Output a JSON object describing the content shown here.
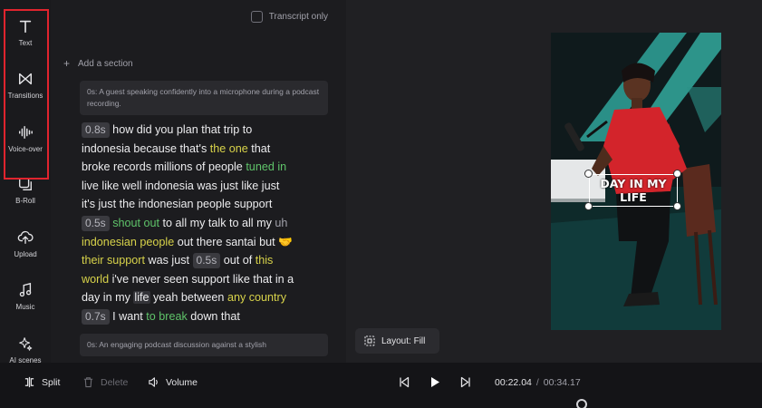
{
  "rail": {
    "items": [
      {
        "label": "Text",
        "icon": "text-icon"
      },
      {
        "label": "Transitions",
        "icon": "transitions-icon"
      },
      {
        "label": "Voice-over",
        "icon": "voice-over-icon"
      },
      {
        "label": "B-Roll",
        "icon": "b-roll-icon"
      },
      {
        "label": "Upload",
        "icon": "upload-icon"
      },
      {
        "label": "Music",
        "icon": "music-icon"
      },
      {
        "label": "AI scenes",
        "icon": "ai-sparkle-icon"
      }
    ],
    "highlight_color": "#e0242e"
  },
  "transcript": {
    "transcript_only_label": "Transcript only",
    "add_section_label": "Add a section",
    "scene_1": "0s:  A guest speaking confidently into a microphone during a podcast recording.",
    "scene_2": "0s:  An engaging podcast discussion against a stylish",
    "lines": [
      [
        {
          "t": "0.8s",
          "c": "ts"
        },
        {
          "t": " how did you plan that trip to"
        }
      ],
      [
        {
          "t": "indonesia because that's "
        },
        {
          "t": "the one",
          "c": "y"
        },
        {
          "t": " that"
        }
      ],
      [
        {
          "t": "broke records millions of people "
        },
        {
          "t": "tuned in",
          "c": "g"
        }
      ],
      [
        {
          "t": "live like well indonesia was just like just"
        }
      ],
      [
        {
          "t": "it's just the indonesian people support"
        }
      ],
      [
        {
          "t": "0.5s",
          "c": "ts"
        },
        {
          "t": " "
        },
        {
          "t": "shout out",
          "c": "g"
        },
        {
          "t": " to all my talk to all my "
        },
        {
          "t": "uh",
          "c": "m"
        }
      ],
      [
        {
          "t": "indonesian people",
          "c": "y"
        },
        {
          "t": " out there santai but "
        },
        {
          "t": "🤝",
          "c": "y"
        }
      ],
      [
        {
          "t": "their support",
          "c": "y"
        },
        {
          "t": " was just "
        },
        {
          "t": "0.5s",
          "c": "ts"
        },
        {
          "t": " out of "
        },
        {
          "t": "this",
          "c": "y"
        }
      ],
      [
        {
          "t": "world",
          "c": "y"
        },
        {
          "t": " i've never seen support like that in a"
        }
      ],
      [
        {
          "t": "day in my "
        },
        {
          "t": "life",
          "c": "sel"
        },
        {
          "t": " yeah between "
        },
        {
          "t": "any country",
          "c": "y"
        }
      ],
      [
        {
          "t": "0.7s",
          "c": "ts"
        },
        {
          "t": " I want "
        },
        {
          "t": "to break",
          "c": "g"
        },
        {
          "t": " down that"
        }
      ]
    ]
  },
  "preview": {
    "caption_line1": "DAY IN MY",
    "caption_line2": "LIFE",
    "layout_label": "Layout: Fill"
  },
  "bottom": {
    "split_label": "Split",
    "delete_label": "Delete",
    "volume_label": "Volume",
    "current_time": "00:22.04",
    "time_separator": "/",
    "total_time": "00:34.17"
  }
}
